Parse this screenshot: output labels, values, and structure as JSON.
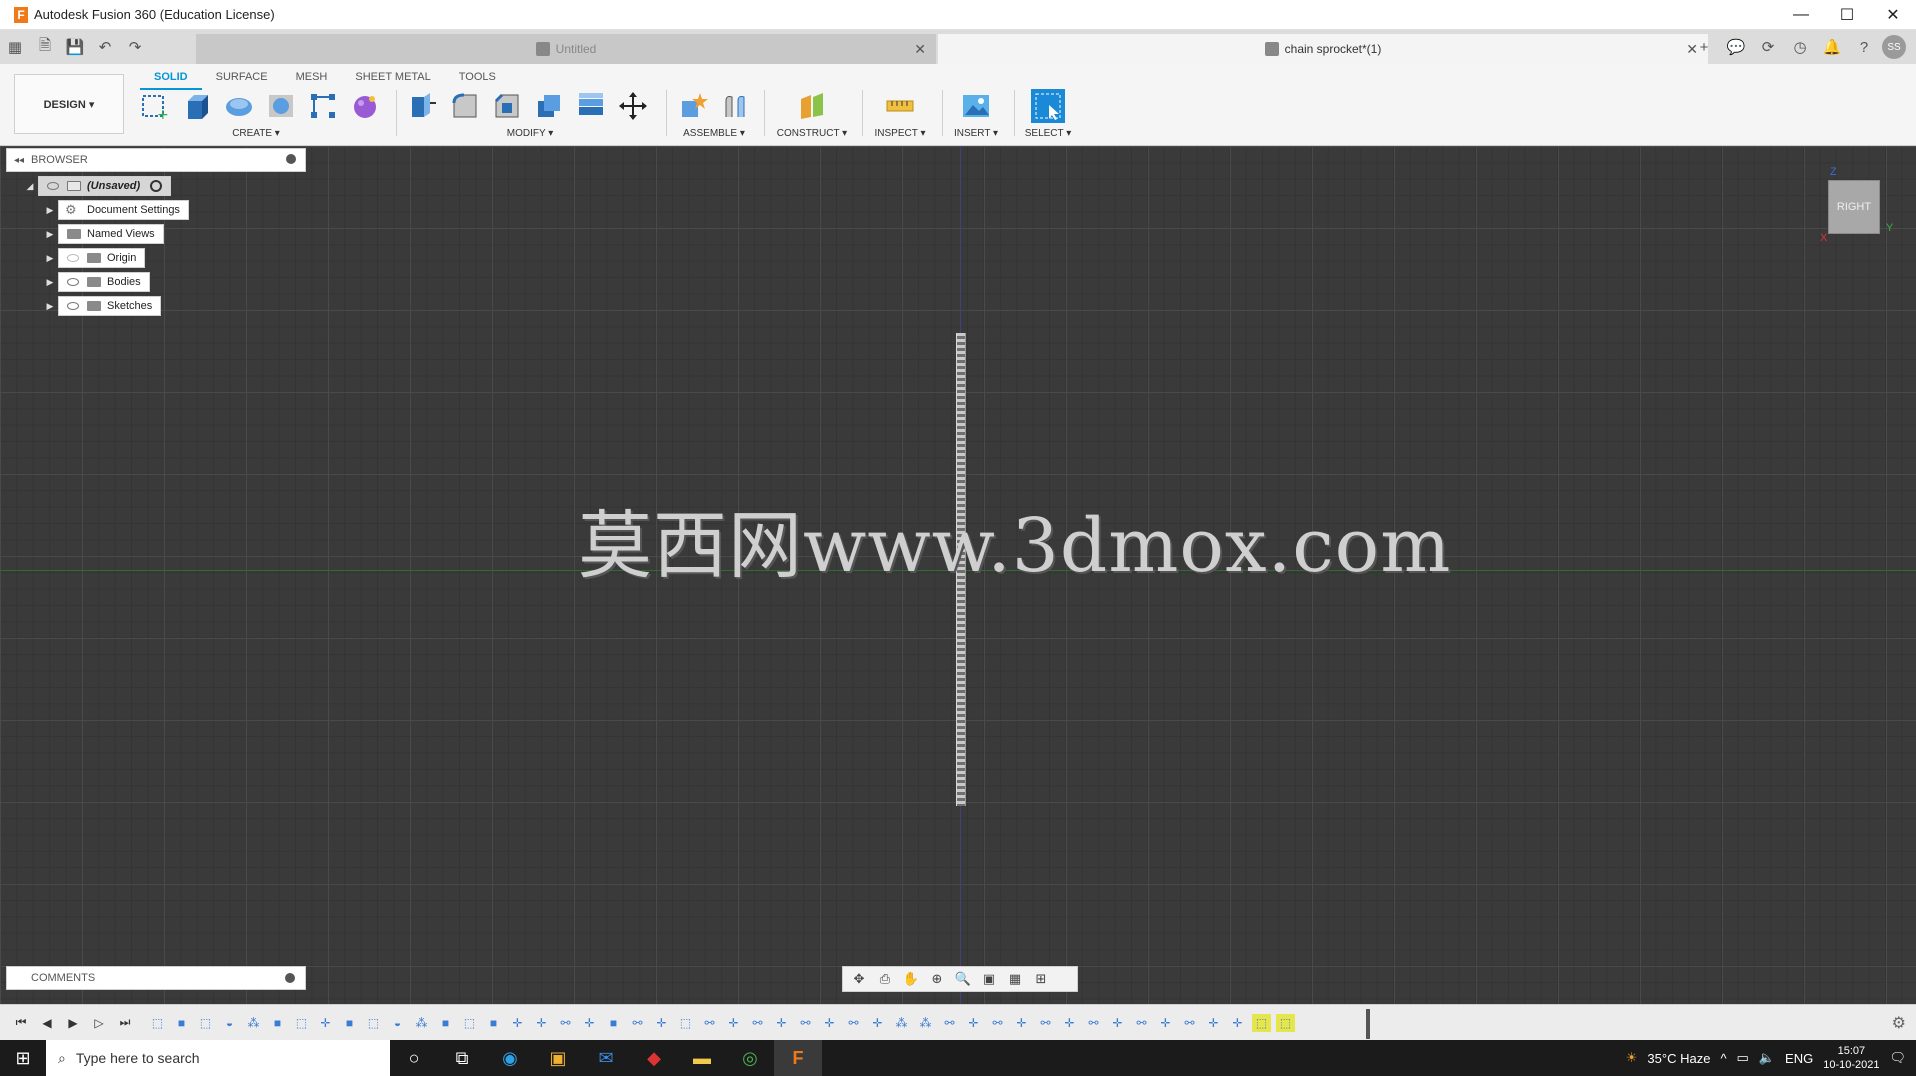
{
  "window": {
    "title": "Autodesk Fusion 360 (Education License)",
    "logo_letter": "F",
    "minimize": "—",
    "maximize": "☐",
    "close": "✕"
  },
  "tabs": [
    {
      "label": "Untitled",
      "close": "✕"
    },
    {
      "label": "chain sprocket*(1)",
      "close": "✕"
    }
  ],
  "header_right": {
    "add": "+",
    "avatar": "SS"
  },
  "ribbon": {
    "workspace_button": "DESIGN ▾",
    "workspace_tabs": [
      "SOLID",
      "SURFACE",
      "MESH",
      "SHEET METAL",
      "TOOLS"
    ],
    "groups": [
      "CREATE ▾",
      "MODIFY ▾",
      "ASSEMBLE ▾",
      "CONSTRUCT ▾",
      "INSPECT ▾",
      "INSERT ▾",
      "SELECT ▾"
    ]
  },
  "browser": {
    "title": "BROWSER",
    "root": "(Unsaved)",
    "items": [
      "Document Settings",
      "Named Views",
      "Origin",
      "Bodies",
      "Sketches"
    ]
  },
  "comments": {
    "title": "COMMENTS"
  },
  "viewcube": {
    "face": "RIGHT",
    "y_axis": "Y",
    "z_axis": "Z",
    "x_axis": "X"
  },
  "watermark": "莫西网www.3dmox.com",
  "taskbar": {
    "search_placeholder": "Type here to search",
    "weather": "35°C  Haze",
    "language": "ENG",
    "time": "15:07",
    "date": "10-10-2021"
  }
}
